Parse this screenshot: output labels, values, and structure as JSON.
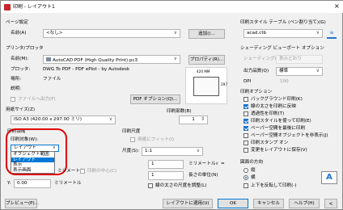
{
  "window": {
    "title": "印刷 - レイアウト1",
    "close": "×"
  },
  "page_setup": {
    "group": "ページ設定",
    "name_label": "名前(A)",
    "name_value": "<なし>",
    "add_button": "追加()..."
  },
  "printer": {
    "group": "プリンタ/プロッタ",
    "name_label": "名前(M):",
    "name_value": "AutoCAD PDF (High Quality Print).pc3",
    "props_button": "プロパティ(R)...",
    "plotter_label": "プロッタ:",
    "plotter_value": "DWG To PDF - PDF ePlot - by Autodesk",
    "where_label": "場所:",
    "where_value": "ファイル",
    "desc_label": "説明:",
    "to_file": "ファイルへ出力(F)",
    "pdf_options": "PDF オプション(Q)...",
    "preview_w": "420 MM",
    "preview_h": "297"
  },
  "paper_size": {
    "label": "用紙サイズ(Z)",
    "value": "ISO A3 (420.00 x 297.00 ミリ)"
  },
  "copies": {
    "label": "印刷部数(B)",
    "value": "1"
  },
  "plot_area": {
    "group": "印刷領域",
    "what_label": "印刷対象(W):",
    "value": "レイアウト",
    "options": [
      "オブジェクト範囲",
      "レイアウト",
      "表示",
      "表示画面"
    ],
    "selected_index": 1
  },
  "plot_offset": {
    "x_unit": "ミリメートル",
    "center": "印刷の中心(C)",
    "y_label": "Y:",
    "y_value": "0.00",
    "y_unit": "ミリメートル"
  },
  "plot_scale": {
    "group": "印刷尺度",
    "fit": "用紙にフィット(I)",
    "scale_label": "尺度(S):",
    "scale_value": "1:1",
    "v1": "1",
    "unit": "ミリメートル",
    "v2": "1",
    "unit2_label": "長さの単位(N)",
    "lw": "線の太さの尺度を調整(L)"
  },
  "plot_style": {
    "group": "印刷スタイル テーブル (ペン割り当て)(G)",
    "value": "acad.ctb"
  },
  "shaded": {
    "group": "シェーディング ビューポート オプション",
    "shade_label": "シェーディング(D)",
    "shade_value": "表示どおり",
    "quality_label": "出力品質(Q)",
    "quality_value": "標準",
    "dpi_label": "DPI",
    "dpi_value": "100"
  },
  "options": {
    "group": "印刷オプション",
    "items": [
      {
        "label": "バックグラウンド印刷(K)",
        "on": false
      },
      {
        "label": "線の太さを印刷に反映",
        "on": true
      },
      {
        "label": "透過性を印刷(T)",
        "on": false
      },
      {
        "label": "印刷スタイルを使って印刷(E)",
        "on": true
      },
      {
        "label": "ペーパー空間を最後に印刷",
        "on": true
      },
      {
        "label": "ペーパー空間オブジェクトを非表示(J)",
        "on": false
      },
      {
        "label": "印刷スタンプ オン",
        "on": false
      },
      {
        "label": "変更をレイアウトに保存(V)",
        "on": false
      }
    ]
  },
  "orientation": {
    "group": "図面の方向",
    "portrait": "縦",
    "landscape": "横",
    "upside": "上下を反転して印刷(-)",
    "icon_letter": "A"
  },
  "bottom": {
    "preview": "プレビュー(P)...",
    "apply": "レイアウトに適用(U)",
    "ok": "OK",
    "cancel": "キャンセル",
    "help": "ヘルプ(H)"
  },
  "colors": {
    "accent": "#1e73d2",
    "highlight_circle": "#e00000"
  }
}
